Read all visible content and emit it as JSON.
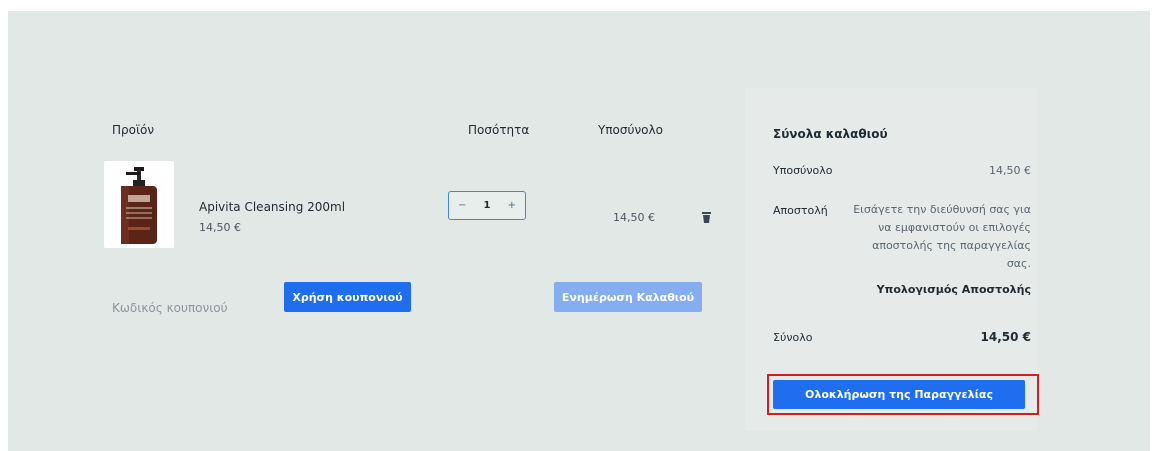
{
  "cart": {
    "headers": {
      "product": "Προϊόν",
      "quantity": "Ποσότητα",
      "subtotal": "Υποσύνολο"
    },
    "items": [
      {
        "name": "Apivita Cleansing 200ml",
        "price": "14,50 €",
        "quantity": "1",
        "subtotal": "14,50 €",
        "remove_icon": "trash-icon"
      }
    ],
    "stepper": {
      "minus": "−",
      "plus": "+"
    },
    "coupon": {
      "placeholder": "Κωδικός κουπονιού",
      "apply_label": "Χρήση κουπονιού"
    },
    "update_label": "Ενημέρωση Καλαθιού"
  },
  "totals": {
    "title": "Σύνολα καλαθιού",
    "subtotal_label": "Υποσύνολο",
    "subtotal_value": "14,50 €",
    "shipping_label": "Αποστολή",
    "shipping_text": "Εισάγετε την διεύθυνσή σας για να εμφανιστούν οι επιλογές αποστολής της παραγγελίας σας.",
    "calc_shipping": "Υπολογισμός Αποστολής",
    "total_label": "Σύνολο",
    "total_value": "14,50 €",
    "checkout_label": "Ολοκλήρωση της Παραγγελίας"
  },
  "colors": {
    "primary": "#1f6ef0",
    "primary_disabled": "#85adf2",
    "highlight_border": "#d11e23",
    "background": "#e2e8e5"
  }
}
